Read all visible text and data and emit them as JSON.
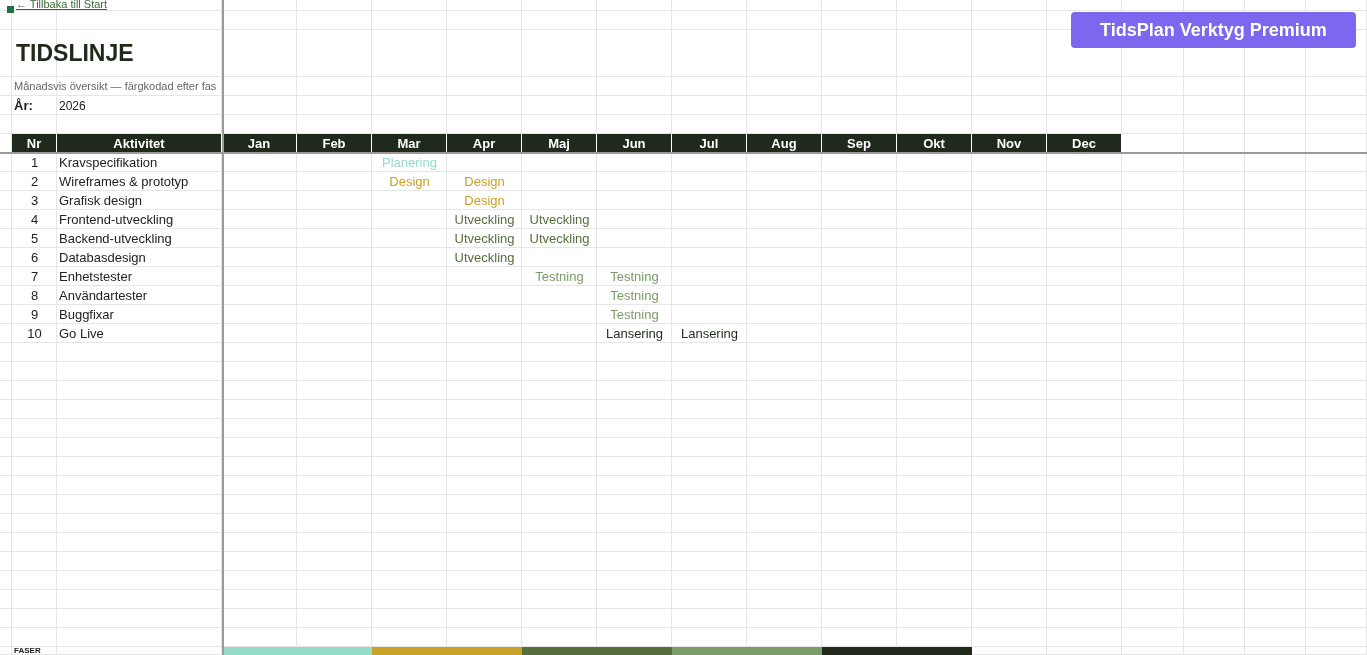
{
  "back_link": "← Tillbaka till Start",
  "badge": "TidsPlan Verktyg Premium",
  "title": "TIDSLINJE",
  "subtitle": "Månadsvis översikt — färgkodad efter fas",
  "year_label": "År:",
  "year": "2026",
  "columns": [
    "Nr",
    "Aktivitet"
  ],
  "months": [
    "Jan",
    "Feb",
    "Mar",
    "Apr",
    "Maj",
    "Jun",
    "Jul",
    "Aug",
    "Sep",
    "Okt",
    "Nov",
    "Dec"
  ],
  "activities": [
    {
      "nr": "1",
      "name": "Kravspecifikation",
      "cells": [
        null,
        null,
        {
          "text": "Planering",
          "color": "#94dcc8"
        },
        null,
        null,
        null,
        null,
        null,
        null,
        null,
        null,
        null
      ]
    },
    {
      "nr": "2",
      "name": "Wireframes & prototyp",
      "cells": [
        null,
        null,
        {
          "text": "Design",
          "color": "#c9a227"
        },
        {
          "text": "Design",
          "color": "#c9a227"
        },
        null,
        null,
        null,
        null,
        null,
        null,
        null,
        null
      ]
    },
    {
      "nr": "3",
      "name": "Grafisk design",
      "cells": [
        null,
        null,
        null,
        {
          "text": "Design",
          "color": "#c9a227"
        },
        null,
        null,
        null,
        null,
        null,
        null,
        null,
        null
      ]
    },
    {
      "nr": "4",
      "name": "Frontend-utveckling",
      "cells": [
        null,
        null,
        null,
        {
          "text": "Utveckling",
          "color": "#566e3d"
        },
        {
          "text": "Utveckling",
          "color": "#566e3d"
        },
        null,
        null,
        null,
        null,
        null,
        null,
        null
      ]
    },
    {
      "nr": "5",
      "name": "Backend-utveckling",
      "cells": [
        null,
        null,
        null,
        {
          "text": "Utveckling",
          "color": "#566e3d"
        },
        {
          "text": "Utveckling",
          "color": "#566e3d"
        },
        null,
        null,
        null,
        null,
        null,
        null,
        null
      ]
    },
    {
      "nr": "6",
      "name": "Databasdesign",
      "cells": [
        null,
        null,
        null,
        {
          "text": "Utveckling",
          "color": "#566e3d"
        },
        null,
        null,
        null,
        null,
        null,
        null,
        null,
        null
      ]
    },
    {
      "nr": "7",
      "name": "Enhetstester",
      "cells": [
        null,
        null,
        null,
        null,
        {
          "text": "Testning",
          "color": "#7a9c67"
        },
        {
          "text": "Testning",
          "color": "#7a9c67"
        },
        null,
        null,
        null,
        null,
        null,
        null
      ]
    },
    {
      "nr": "8",
      "name": "Användartester",
      "cells": [
        null,
        null,
        null,
        null,
        null,
        {
          "text": "Testning",
          "color": "#7a9c67"
        },
        null,
        null,
        null,
        null,
        null,
        null
      ]
    },
    {
      "nr": "9",
      "name": "Buggfixar",
      "cells": [
        null,
        null,
        null,
        null,
        null,
        {
          "text": "Testning",
          "color": "#7a9c67"
        },
        null,
        null,
        null,
        null,
        null,
        null
      ]
    },
    {
      "nr": "10",
      "name": "Go Live",
      "cells": [
        null,
        null,
        null,
        null,
        null,
        {
          "text": "Lansering",
          "color": "#1f2a1c"
        },
        {
          "text": "Lansering",
          "color": "#1f2a1c"
        },
        null,
        null,
        null,
        null,
        null
      ]
    }
  ],
  "phases_label": "FASER",
  "phases": [
    {
      "color": "#94dcc8"
    },
    {
      "color": "#c9a227"
    },
    {
      "color": "#566e3d"
    },
    {
      "color": "#7a9c67"
    },
    {
      "color": "#1f2a1c"
    }
  ]
}
